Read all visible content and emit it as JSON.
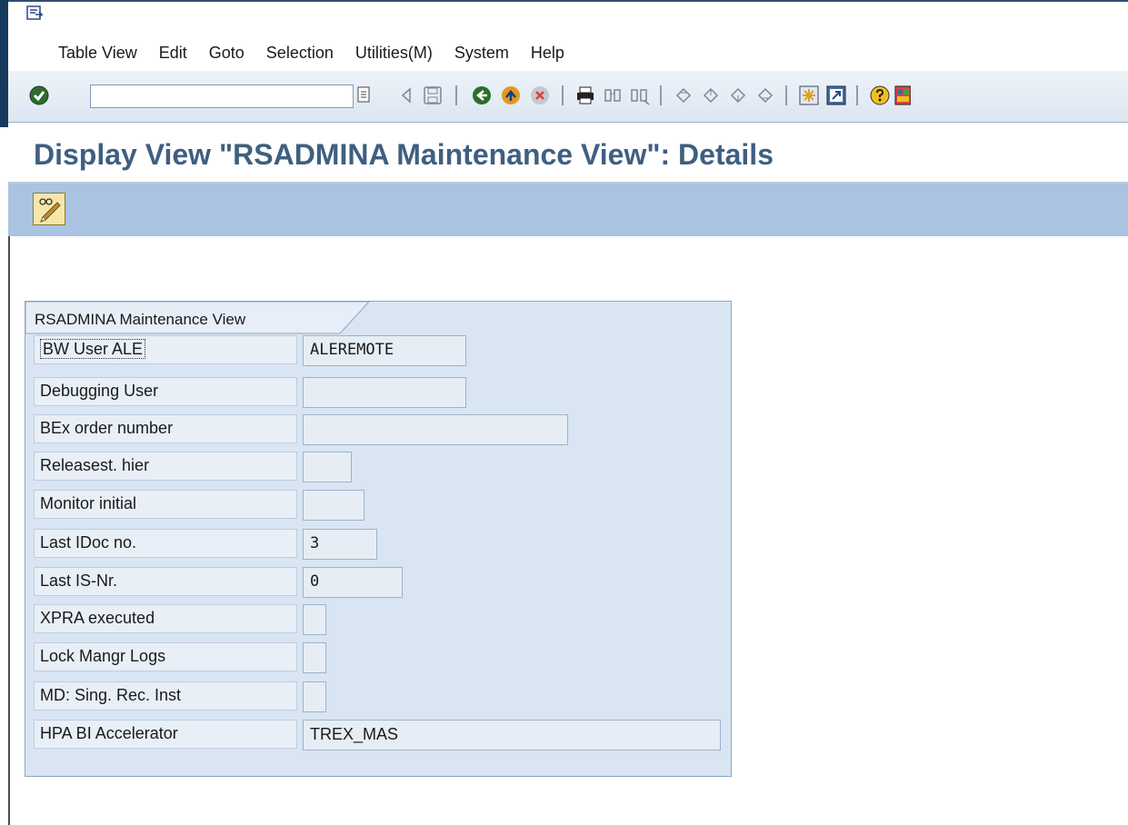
{
  "menu": {
    "items": [
      {
        "label": "Table View"
      },
      {
        "label": "Edit"
      },
      {
        "label": "Goto"
      },
      {
        "label": "Selection"
      },
      {
        "label": "Utilities(M)"
      },
      {
        "label": "System"
      },
      {
        "label": "Help"
      }
    ]
  },
  "toolbar": {
    "command_field_value": "",
    "icons": [
      "enter-icon",
      "command-dropdown-icon",
      "back-arrow-icon",
      "save-icon",
      "back-icon",
      "exit-icon",
      "cancel-icon",
      "print-icon",
      "find-icon",
      "find-next-icon",
      "first-page-icon",
      "previous-page-icon",
      "next-page-icon",
      "last-page-icon",
      "create-session-icon",
      "shortcut-icon",
      "help-icon",
      "layout-icon"
    ]
  },
  "title": "Display View \"RSADMINA Maintenance View\": Details",
  "app_toolbar": {
    "icons": [
      "display-change-icon"
    ]
  },
  "group": {
    "title": "RSADMINA Maintenance View",
    "rows": [
      {
        "label": "BW User ALE",
        "value": "ALEREMOTE"
      },
      {
        "label": "Debugging User",
        "value": ""
      },
      {
        "label": "BEx order number",
        "value": ""
      },
      {
        "label": "Releasest. hier",
        "value": ""
      },
      {
        "label": "Monitor initial",
        "value": ""
      },
      {
        "label": "Last IDoc no.",
        "value": "3"
      },
      {
        "label": "Last IS-Nr.",
        "value": "0"
      },
      {
        "label": "XPRA executed",
        "value": ""
      },
      {
        "label": "Lock Mangr Logs",
        "value": ""
      },
      {
        "label": "MD: Sing. Rec. Inst",
        "value": ""
      },
      {
        "label": "HPA BI Accelerator",
        "value": "TREX_MAS"
      }
    ]
  },
  "colors": {
    "title_text": "#3f5f80",
    "app_toolbar": "#a9c3e0",
    "group_bg": "#d9e5f2",
    "menu_separator": "#e0a34a"
  }
}
